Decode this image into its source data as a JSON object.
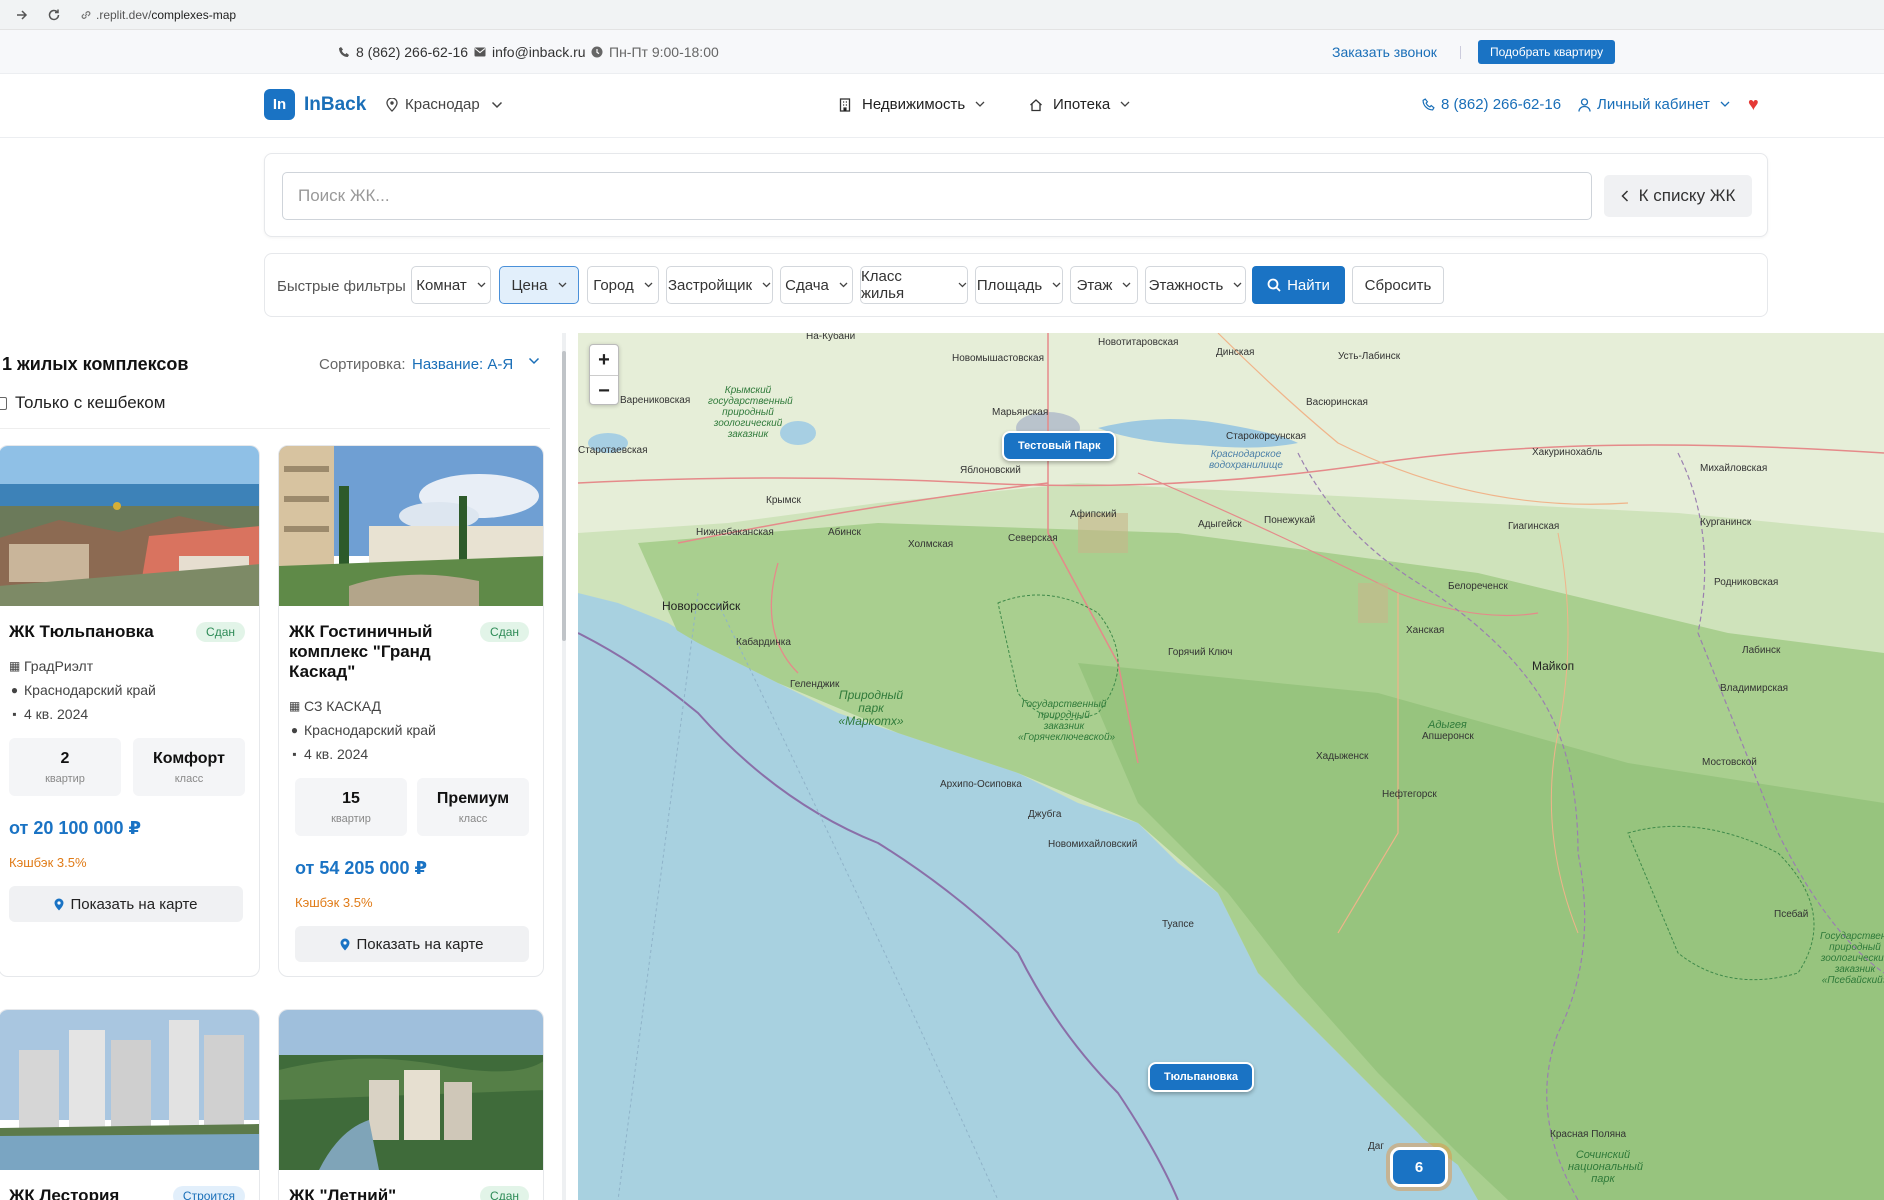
{
  "browser": {
    "url_host": ".replit.dev/",
    "url_path": "complexes-map"
  },
  "topbar": {
    "phone": "8 (862) 266-62-16",
    "email": "info@inback.ru",
    "hours": "Пн-Пт 9:00-18:00",
    "callback_label": "Заказать звонок",
    "pick_apartment_label": "Подобрать квартиру"
  },
  "header": {
    "logo_mark": "In",
    "logo_text": "InBack",
    "city": "Краснодар",
    "nav": {
      "realty": "Недвижимость",
      "mortgage": "Ипотека"
    },
    "phone": "8 (862) 266-62-16",
    "cabinet": "Личный кабинет"
  },
  "search": {
    "placeholder": "Поиск ЖК...",
    "back_label": "К списку ЖК"
  },
  "filters": {
    "label": "Быстрые фильтры",
    "items": [
      "Комнат",
      "Цена",
      "Город",
      "Застройщик",
      "Сдача",
      "Класс жилья",
      "Площадь",
      "Этаж",
      "Этажность"
    ],
    "active": "Цена",
    "find_label": "Найти",
    "reset_label": "Сбросить"
  },
  "list": {
    "count_title": "1 жилых комплексов",
    "sort_label": "Сортировка:",
    "sort_value": "Название: А-Я",
    "cashback_only": "Только с кешбеком",
    "cards": [
      {
        "name": "ЖК Тюльпановка",
        "status": "Сдан",
        "developer": "ГрадРиэлт",
        "region": "Краснодарский край",
        "deadline": "4 кв. 2024",
        "apartments": "2",
        "apartments_label": "квартир",
        "class": "Комфорт",
        "class_label": "класс",
        "price": "от 20 100 000 ₽",
        "cashback": "Кэшбэк 3.5%",
        "map_button": "Показать на карте"
      },
      {
        "name": "ЖК Гостиничный комплекс \"Гранд Каскад\"",
        "status": "Сдан",
        "developer": "СЗ КАСКАД",
        "region": "Краснодарский край",
        "deadline": "4 кв. 2024",
        "apartments": "15",
        "apartments_label": "квартир",
        "class": "Премиум",
        "class_label": "класс",
        "price": "от 54 205 000 ₽",
        "cashback": "Кэшбэк 3.5%",
        "map_button": "Показать на карте"
      },
      {
        "name": "ЖК Лестория",
        "status": "Строится"
      },
      {
        "name": "ЖК \"Летний\"",
        "status": "Сдан"
      }
    ]
  },
  "map": {
    "zoom_in": "+",
    "zoom_out": "−",
    "markers": [
      "Тестовый Парк",
      "Тюльпановка"
    ],
    "cluster_count": "6",
    "labels": {
      "l1": "Новотитаровская",
      "l2": "Динская",
      "l3": "Усть-Лабинск",
      "l4": "Новомышастовская",
      "l5": "На-Кубани",
      "l6": "Варениковская",
      "l7": "Марьянская",
      "l8": "Васюринская",
      "l9": "Старокорсунская",
      "l10": "Хакуринохабль",
      "l11": "Михайловская",
      "l12": "Старотаевская",
      "l13": "Яблоновский",
      "l14": "Крымск",
      "l15": "Афипский",
      "l16": "Адыгейск",
      "l17": "Понежукай",
      "l18": "Нижнебаканская",
      "l19": "Абинск",
      "l20": "Холмская",
      "l21": "Северская",
      "l22": "Гиагинская",
      "l23": "Курганинск",
      "l24": "Новороссийск",
      "l25": "Белореченск",
      "l26": "Родниковская",
      "l27": "Кабардинка",
      "l28": "Горячий Ключ",
      "l29": "Ханская",
      "l30": "Майкоп",
      "l31": "Лабинск",
      "l32": "Геленджик",
      "l33": "Владимирская",
      "l34": "Апшеронск",
      "l35": "Хадыженск",
      "l36": "Мостовской",
      "l37": "Архипо-Осиповка",
      "l38": "Нефтегорск",
      "l39": "Джубга",
      "l40": "Новомихайловский",
      "l41": "Псебай",
      "l42": "Туапсе",
      "l43": "Красная Поляна",
      "l44": "Даг",
      "l45": "Адыгея"
    },
    "green_labels": {
      "g1": "Крымский государственный природный зоологический заказник",
      "g2": "Природный парк «Маркотх»",
      "g3": "Государственный природный заказник «Горячеключевской»",
      "g4": "Государственный природный зоологический заказник «Псебайский»",
      "g5": "Сочинский национальный парк",
      "g6": "Краснодарское водохранилище"
    }
  },
  "colors": {
    "accent": "#1a73c4",
    "cashback": "#e07b17",
    "badge_done": "#2e8b57",
    "heart": "#e53935"
  }
}
